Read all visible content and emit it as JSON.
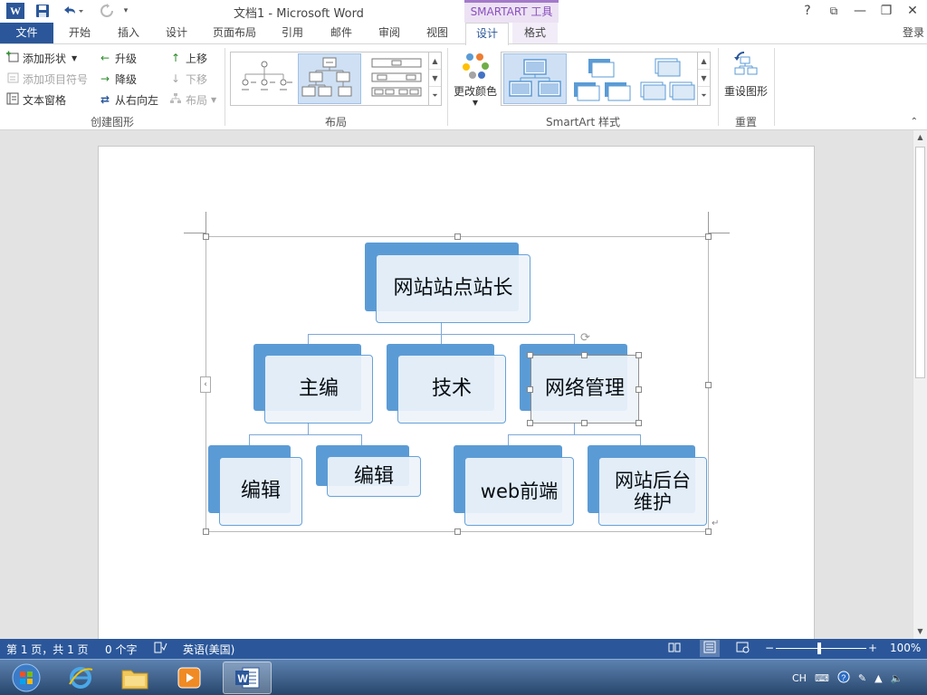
{
  "window": {
    "title": "文档1 - Microsoft Word",
    "contextual_group": "SMARTART 工具",
    "logo_letter": "W",
    "controls": [
      "?",
      "⧉",
      "—",
      "❐",
      "✕"
    ]
  },
  "tabs": [
    "文件",
    "开始",
    "插入",
    "设计",
    "页面布局",
    "引用",
    "邮件",
    "审阅",
    "视图",
    "设计",
    "格式"
  ],
  "active_tab": "设计",
  "login": "登录",
  "ribbon": {
    "create_graphic": {
      "label": "创建图形",
      "add_shape": "添加形状",
      "add_bullet": "添加项目符号",
      "text_pane": "文本窗格",
      "promote": "升级",
      "demote": "降级",
      "right_to_left": "从右向左",
      "move_up": "上移",
      "move_down": "下移",
      "layout": "布局"
    },
    "layouts": {
      "label": "布局"
    },
    "styles": {
      "label": "SmartArt 样式",
      "change_colors": "更改颜色"
    },
    "reset": {
      "label": "重置",
      "reset_graphic": "重设图形"
    }
  },
  "smartart": {
    "root": "网站站点站长",
    "level2": [
      "主编",
      "技术",
      "网络管理"
    ],
    "level3": [
      "编辑",
      "编辑",
      "web前端",
      "网站后台维护"
    ]
  },
  "statusbar": {
    "page": "第 1 页，共 1 页",
    "words": "0 个字",
    "language": "英语(美国)",
    "zoom": "100%"
  },
  "taskbar": {
    "tray_lang": "CH"
  },
  "colors": {
    "word_blue": "#2b579a",
    "smartart_blue": "#5b9bd5",
    "contextual_purple": "#8a4fbc"
  }
}
